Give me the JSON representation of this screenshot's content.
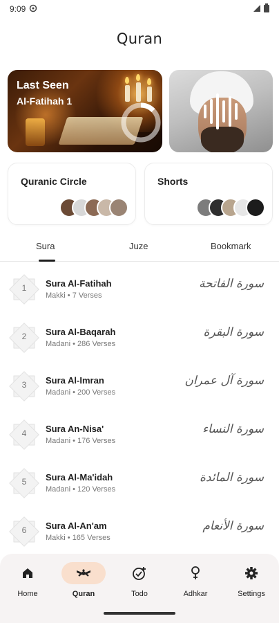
{
  "status_bar": {
    "time": "9:09"
  },
  "header": {
    "title": "Quran"
  },
  "last_seen": {
    "title": "Last Seen",
    "surah": "Al-Fatihah 1"
  },
  "quick_cards": {
    "circle_label": "Quranic Circle",
    "shorts_label": "Shorts"
  },
  "tabs": [
    {
      "label": "Sura",
      "active": true
    },
    {
      "label": "Juze",
      "active": false
    },
    {
      "label": "Bookmark",
      "active": false
    }
  ],
  "suras": [
    {
      "number": "1",
      "name": "Sura Al-Fatihah",
      "meta": "Makki • 7 Verses",
      "arabic": "سورة الفاتحة"
    },
    {
      "number": "2",
      "name": "Sura Al-Baqarah",
      "meta": "Madani • 286 Verses",
      "arabic": "سورة البقرة"
    },
    {
      "number": "3",
      "name": "Sura Al-Imran",
      "meta": "Madani • 200 Verses",
      "arabic": "سورة آل عمران"
    },
    {
      "number": "4",
      "name": "Sura An-Nisa'",
      "meta": "Madani • 176 Verses",
      "arabic": "سورة النساء"
    },
    {
      "number": "5",
      "name": "Sura Al-Ma'idah",
      "meta": "Madani • 120 Verses",
      "arabic": "سورة المائدة"
    },
    {
      "number": "6",
      "name": "Sura Al-An'am",
      "meta": "Makki • 165 Verses",
      "arabic": "سورة الأنعام"
    }
  ],
  "nav": [
    {
      "label": "Home",
      "icon": "home-icon",
      "active": false
    },
    {
      "label": "Quran",
      "icon": "quran-icon",
      "active": true
    },
    {
      "label": "Todo",
      "icon": "todo-icon",
      "active": false
    },
    {
      "label": "Adhkar",
      "icon": "adhkar-icon",
      "active": false
    },
    {
      "label": "Settings",
      "icon": "settings-icon",
      "active": false
    }
  ],
  "colors": {
    "accent": "#f9dfcd",
    "nav_bg": "#f6f3f3",
    "text": "#222222"
  }
}
